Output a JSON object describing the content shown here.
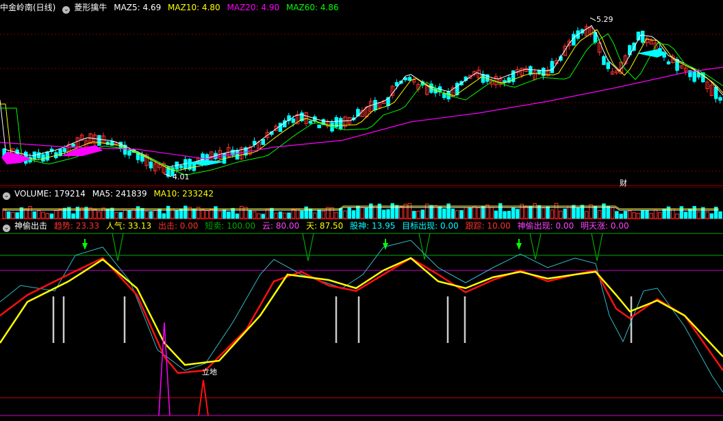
{
  "price_panel": {
    "title": "中金岭南(日线)",
    "indicator": "菱形擒牛",
    "ma": [
      {
        "label": "MAZ5: 4.69",
        "color": "#ffffff"
      },
      {
        "label": "MAZ10: 4.80",
        "color": "#ffff00"
      },
      {
        "label": "MAZ20: 4.90",
        "color": "#ff00ff"
      },
      {
        "label": "MAZ60: 4.86",
        "color": "#00ff00"
      }
    ],
    "high_label": "5.29",
    "low_label": "4.01",
    "fin_label": "财"
  },
  "volume_panel": {
    "items": [
      {
        "label": "VOLUME: 179214",
        "color": "#ffffff"
      },
      {
        "label": "MA5: 241839",
        "color": "#ffffff"
      },
      {
        "label": "MA10: 233242",
        "color": "#ffff00"
      }
    ]
  },
  "indicator_panel": {
    "items": [
      {
        "label": "神偷出击",
        "color": "#ffffff"
      },
      {
        "label": "趋势: 23.33",
        "color": "#ff3030"
      },
      {
        "label": "人气: 33.13",
        "color": "#ffff00"
      },
      {
        "label": "出击: 0.00",
        "color": "#ff3030"
      },
      {
        "label": "短卖: 100.00",
        "color": "#00aa00"
      },
      {
        "label": "云: 80.00",
        "color": "#ff40ff"
      },
      {
        "label": "天: 87.50",
        "color": "#ffff00"
      },
      {
        "label": "股神: 13.95",
        "color": "#00ffff"
      },
      {
        "label": "目标出现: 0.00",
        "color": "#00ffff"
      },
      {
        "label": "跟踪: 10.00",
        "color": "#ff3030"
      },
      {
        "label": "神偷出现: 0.00",
        "color": "#ff40ff"
      },
      {
        "label": "明天涨: 0.00",
        "color": "#ff40ff"
      }
    ],
    "ground_label": "立地"
  },
  "colors": {
    "up": "#ff3030",
    "down": "#00ffff",
    "grid": "#800000",
    "bg": "#000000"
  }
}
